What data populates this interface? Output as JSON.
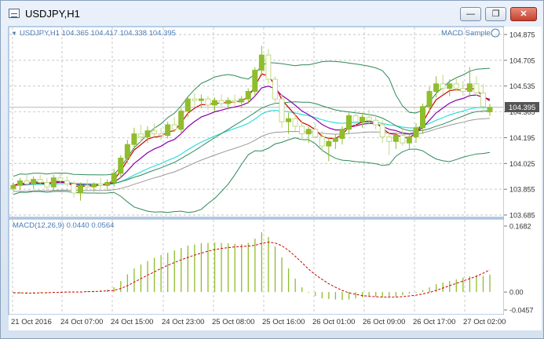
{
  "window": {
    "title": "USDJPY,H1",
    "minimize_label": "—",
    "restore_label": "❐",
    "close_label": "✕"
  },
  "price_panel": {
    "header": "USDJPY,H1  104.365 104.417 104.338 104.395",
    "expert_label": "MACD Sample",
    "current_price": "104.395",
    "y_ticks": [
      "104.875",
      "104.705",
      "104.535",
      "104.365",
      "104.195",
      "104.025",
      "103.855",
      "103.685"
    ],
    "y_range": [
      103.685,
      104.875
    ]
  },
  "macd_panel": {
    "header": "MACD(12,26,9) 0.0440 0.0564",
    "y_ticks": [
      "0.1682",
      "0.00",
      "-0.0457"
    ],
    "y_range": [
      -0.0457,
      0.1682
    ]
  },
  "x_axis": {
    "labels": [
      "21 Oct 2016",
      "24 Oct 07:00",
      "24 Oct 15:00",
      "24 Oct 23:00",
      "25 Oct 08:00",
      "25 Oct 16:00",
      "26 Oct 01:00",
      "26 Oct 09:00",
      "26 Oct 17:00",
      "27 Oct 02:00"
    ]
  },
  "colors": {
    "bull": "#8fbd2c",
    "bear": "#c2d989",
    "grid": "#b3b3b3",
    "frame": "#7ea0c8",
    "text": "#4a7bb5",
    "ma_red": "#cc0000",
    "ma_purple": "#8800aa",
    "ma_cyan": "#33dddd",
    "ma_gray": "#999999",
    "bands": "#2e8b57",
    "signal": "#cc0000"
  },
  "chart_data": {
    "type": "candlestick",
    "symbol": "USDJPY",
    "timeframe": "H1",
    "ohlc_last": {
      "open": 104.365,
      "high": 104.417,
      "low": 104.338,
      "close": 104.395
    },
    "candles": [
      [
        103.86,
        103.9,
        103.84,
        103.88
      ],
      [
        103.88,
        103.93,
        103.85,
        103.91
      ],
      [
        103.91,
        103.96,
        103.88,
        103.89
      ],
      [
        103.89,
        103.94,
        103.86,
        103.92
      ],
      [
        103.92,
        103.95,
        103.88,
        103.9
      ],
      [
        103.9,
        103.93,
        103.85,
        103.87
      ],
      [
        103.87,
        103.95,
        103.84,
        103.93
      ],
      [
        103.93,
        103.96,
        103.89,
        103.91
      ],
      [
        103.91,
        103.94,
        103.87,
        103.89
      ],
      [
        103.89,
        103.91,
        103.8,
        103.83
      ],
      [
        103.83,
        103.9,
        103.78,
        103.88
      ],
      [
        103.88,
        103.92,
        103.85,
        103.87
      ],
      [
        103.87,
        103.9,
        103.84,
        103.89
      ],
      [
        103.89,
        103.93,
        103.86,
        103.88
      ],
      [
        103.88,
        103.92,
        103.85,
        103.9
      ],
      [
        103.9,
        103.99,
        103.87,
        103.96
      ],
      [
        103.96,
        104.08,
        103.93,
        104.06
      ],
      [
        104.06,
        104.18,
        104.03,
        104.15
      ],
      [
        104.15,
        104.26,
        104.12,
        104.22
      ],
      [
        104.22,
        104.28,
        104.17,
        104.2
      ],
      [
        104.2,
        104.27,
        104.16,
        104.24
      ],
      [
        104.24,
        104.29,
        104.2,
        104.22
      ],
      [
        104.22,
        104.26,
        104.18,
        104.21
      ],
      [
        104.21,
        104.3,
        104.19,
        104.28
      ],
      [
        104.28,
        104.33,
        104.23,
        104.25
      ],
      [
        104.25,
        104.39,
        104.22,
        104.37
      ],
      [
        104.37,
        104.47,
        104.33,
        104.45
      ],
      [
        104.45,
        104.49,
        104.4,
        104.44
      ],
      [
        104.44,
        104.48,
        104.39,
        104.45
      ],
      [
        104.45,
        104.47,
        104.38,
        104.41
      ],
      [
        104.41,
        104.46,
        104.37,
        104.44
      ],
      [
        104.44,
        104.48,
        104.4,
        104.42
      ],
      [
        104.42,
        104.46,
        104.38,
        104.44
      ],
      [
        104.44,
        104.48,
        104.4,
        104.43
      ],
      [
        104.43,
        104.47,
        104.39,
        104.45
      ],
      [
        104.45,
        104.52,
        104.42,
        104.5
      ],
      [
        104.5,
        104.66,
        104.47,
        104.64
      ],
      [
        104.64,
        104.8,
        104.6,
        104.74
      ],
      [
        104.74,
        104.78,
        104.55,
        104.58
      ],
      [
        104.58,
        104.6,
        104.42,
        104.45
      ],
      [
        104.45,
        104.48,
        104.26,
        104.3
      ],
      [
        104.3,
        104.36,
        104.22,
        104.32
      ],
      [
        104.32,
        104.37,
        104.24,
        104.27
      ],
      [
        104.27,
        104.31,
        104.18,
        104.22
      ],
      [
        104.22,
        104.27,
        104.16,
        104.25
      ],
      [
        104.25,
        104.29,
        104.19,
        104.2
      ],
      [
        104.2,
        104.24,
        104.1,
        104.14
      ],
      [
        104.14,
        104.2,
        104.04,
        104.17
      ],
      [
        104.17,
        104.22,
        104.12,
        104.19
      ],
      [
        104.19,
        104.27,
        104.15,
        104.25
      ],
      [
        104.25,
        104.36,
        104.22,
        104.34
      ],
      [
        104.34,
        104.38,
        104.27,
        104.3
      ],
      [
        104.3,
        104.36,
        104.26,
        104.33
      ],
      [
        104.33,
        104.38,
        104.28,
        104.31
      ],
      [
        104.31,
        104.35,
        104.25,
        104.28
      ],
      [
        104.28,
        104.31,
        104.16,
        104.2
      ],
      [
        104.2,
        104.24,
        104.08,
        104.17
      ],
      [
        104.17,
        104.23,
        104.12,
        104.21
      ],
      [
        104.21,
        104.25,
        104.14,
        104.16
      ],
      [
        104.16,
        104.22,
        104.12,
        104.2
      ],
      [
        104.2,
        104.29,
        104.16,
        104.26
      ],
      [
        104.26,
        104.42,
        104.22,
        104.4
      ],
      [
        104.4,
        104.53,
        104.36,
        104.5
      ],
      [
        104.5,
        104.6,
        104.46,
        104.55
      ],
      [
        104.55,
        104.61,
        104.48,
        104.52
      ],
      [
        104.52,
        104.58,
        104.47,
        104.55
      ],
      [
        104.55,
        104.59,
        104.5,
        104.52
      ],
      [
        104.52,
        104.57,
        104.47,
        104.5
      ],
      [
        104.5,
        104.66,
        104.46,
        104.55
      ],
      [
        104.55,
        104.6,
        104.47,
        104.49
      ],
      [
        104.49,
        104.55,
        104.36,
        104.4
      ],
      [
        104.365,
        104.417,
        104.338,
        104.395
      ]
    ],
    "macd_histogram": [
      -0.003,
      -0.004,
      -0.004,
      -0.003,
      -0.002,
      -0.002,
      -0.001,
      0.0,
      0.001,
      0.001,
      0.001,
      0.002,
      0.003,
      0.004,
      0.006,
      0.012,
      0.028,
      0.045,
      0.06,
      0.07,
      0.079,
      0.087,
      0.094,
      0.1,
      0.106,
      0.112,
      0.118,
      0.121,
      0.124,
      0.125,
      0.126,
      0.125,
      0.124,
      0.123,
      0.122,
      0.125,
      0.136,
      0.152,
      0.14,
      0.116,
      0.088,
      0.06,
      0.034,
      0.012,
      -0.002,
      -0.01,
      -0.016,
      -0.018,
      -0.019,
      -0.02,
      -0.019,
      -0.016,
      -0.014,
      -0.012,
      -0.012,
      -0.013,
      -0.014,
      -0.012,
      -0.008,
      -0.004,
      -0.002,
      0.005,
      0.012,
      0.02,
      0.024,
      0.028,
      0.032,
      0.037,
      0.04,
      0.043,
      0.041,
      0.044
    ],
    "macd_signal": [
      -0.002,
      -0.002,
      -0.003,
      -0.003,
      -0.002,
      -0.002,
      -0.001,
      -0.001,
      0.0,
      0.0,
      0.0,
      0.001,
      0.001,
      0.002,
      0.003,
      0.004,
      0.009,
      0.016,
      0.025,
      0.034,
      0.043,
      0.051,
      0.06,
      0.068,
      0.075,
      0.082,
      0.088,
      0.094,
      0.099,
      0.104,
      0.108,
      0.111,
      0.113,
      0.115,
      0.116,
      0.117,
      0.119,
      0.124,
      0.127,
      0.125,
      0.118,
      0.106,
      0.091,
      0.075,
      0.058,
      0.044,
      0.032,
      0.021,
      0.012,
      0.004,
      -0.002,
      -0.006,
      -0.009,
      -0.011,
      -0.012,
      -0.013,
      -0.013,
      -0.013,
      -0.012,
      -0.01,
      -0.008,
      -0.005,
      -0.001,
      0.004,
      0.01,
      0.016,
      0.022,
      0.028,
      0.034,
      0.04,
      0.048,
      0.0564
    ]
  }
}
